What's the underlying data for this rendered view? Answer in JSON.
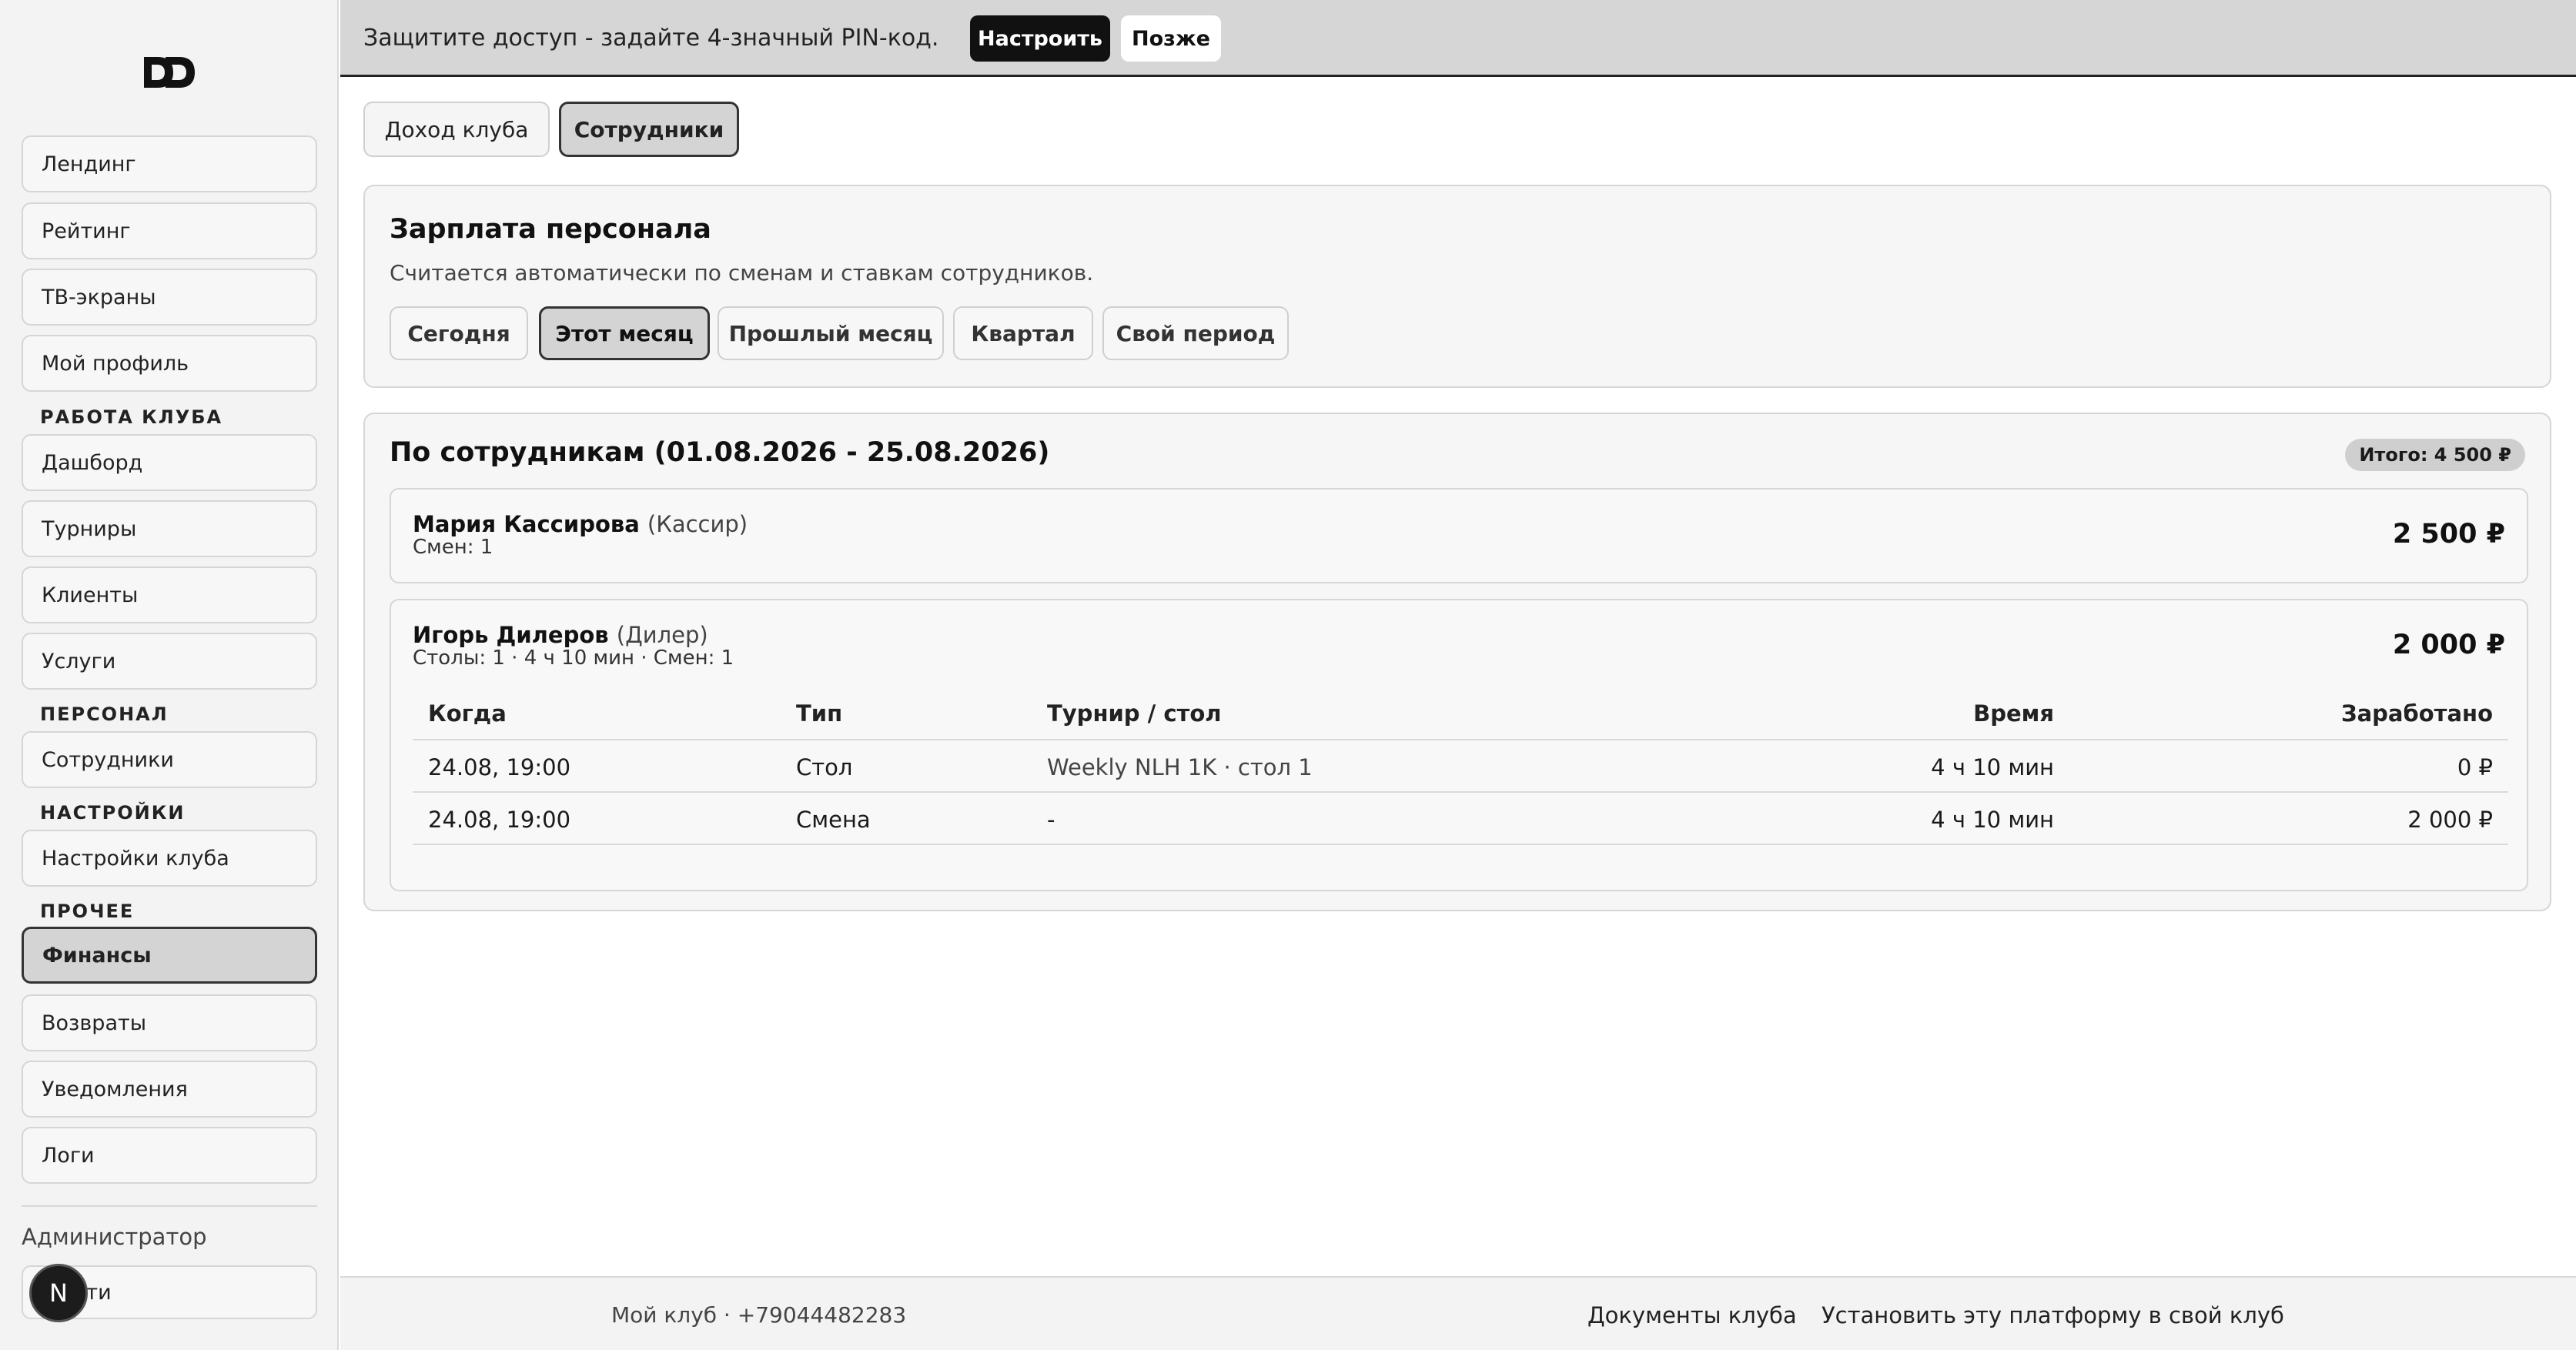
{
  "sidebar": {
    "logo_text": "DD",
    "items_top": [
      {
        "label": "Лендинг"
      },
      {
        "label": "Рейтинг"
      },
      {
        "label": "ТВ-экраны"
      },
      {
        "label": "Мой профиль"
      }
    ],
    "section_club": "РАБОТА КЛУБА",
    "items_club": [
      {
        "label": "Дашборд"
      },
      {
        "label": "Турниры"
      },
      {
        "label": "Клиенты"
      },
      {
        "label": "Услуги"
      }
    ],
    "section_staff": "ПЕРСОНАЛ",
    "items_staff": [
      {
        "label": "Сотрудники"
      }
    ],
    "section_settings": "НАСТРОЙКИ",
    "items_settings": [
      {
        "label": "Настройки клуба"
      }
    ],
    "section_other": "ПРОЧЕЕ",
    "items_other": [
      {
        "label": "Финансы",
        "active": true
      },
      {
        "label": "Возвраты"
      },
      {
        "label": "Уведомления"
      },
      {
        "label": "Логи"
      }
    ],
    "role_label": "Администратор",
    "logout_label": "Выйти",
    "avatar_letter": "N"
  },
  "banner": {
    "text": "Защитите доступ - задайте 4-значный PIN-код.",
    "configure_label": "Настроить",
    "later_label": "Позже"
  },
  "tabs": [
    {
      "label": "Доход клуба"
    },
    {
      "label": "Сотрудники",
      "active": true
    }
  ],
  "salary": {
    "title": "Зарплата персонала",
    "subtitle": "Считается автоматически по сменам и ставкам сотрудников.",
    "periods": [
      {
        "label": "Сегодня"
      },
      {
        "label": "Этот месяц",
        "active": true
      },
      {
        "label": "Прошлый месяц"
      },
      {
        "label": "Квартал"
      },
      {
        "label": "Свой период"
      }
    ]
  },
  "by_employee": {
    "title": "По сотрудникам (01.08.2026 - 25.08.2026)",
    "total": "Итого: 4 500 ₽",
    "employees": [
      {
        "name": "Мария Кассирова",
        "role": "(Кассир)",
        "meta": "Смен: 1",
        "amount": "2 500 ₽"
      },
      {
        "name": "Игорь Дилеров",
        "role": "(Дилер)",
        "meta": "Столы: 1 · 4 ч 10 мин · Смен: 1",
        "amount": "2 000 ₽",
        "table": {
          "headers": [
            "Когда",
            "Тип",
            "Турнир / стол",
            "Время",
            "Заработано"
          ],
          "rows": [
            [
              "24.08, 19:00",
              "Стол",
              "Weekly NLH 1K · стол 1",
              "4 ч 10 мин",
              "0 ₽"
            ],
            [
              "24.08, 19:00",
              "Смена",
              "-",
              "4 ч 10 мин",
              "2 000 ₽"
            ]
          ]
        }
      }
    ]
  },
  "footer": {
    "club": "Мой клуб · +79044482283",
    "docs_link": "Документы клуба",
    "install_link": "Установить эту платформу в свой клуб"
  },
  "colors": {
    "accent_dark": "#111111",
    "active_bg": "#d4d4d4",
    "banner_bg": "#d6d6d6"
  }
}
